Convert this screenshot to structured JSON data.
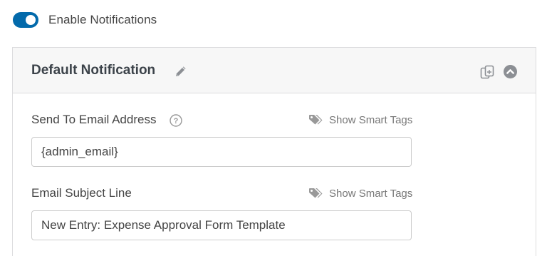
{
  "toggle": {
    "label": "Enable Notifications",
    "enabled": true,
    "color": "#036aab"
  },
  "notification": {
    "title": "Default Notification",
    "icons": [
      "pencil-icon",
      "clone-icon",
      "collapse-up-icon"
    ],
    "fields": [
      {
        "label": "Send To Email Address",
        "has_help": true,
        "help_icon": "question-circle-icon",
        "smart_tags_label": "Show Smart Tags",
        "value": "{admin_email}"
      },
      {
        "label": "Email Subject Line",
        "has_help": false,
        "smart_tags_label": "Show Smart Tags",
        "value": "New Entry: Expense Approval Form Template"
      }
    ]
  }
}
